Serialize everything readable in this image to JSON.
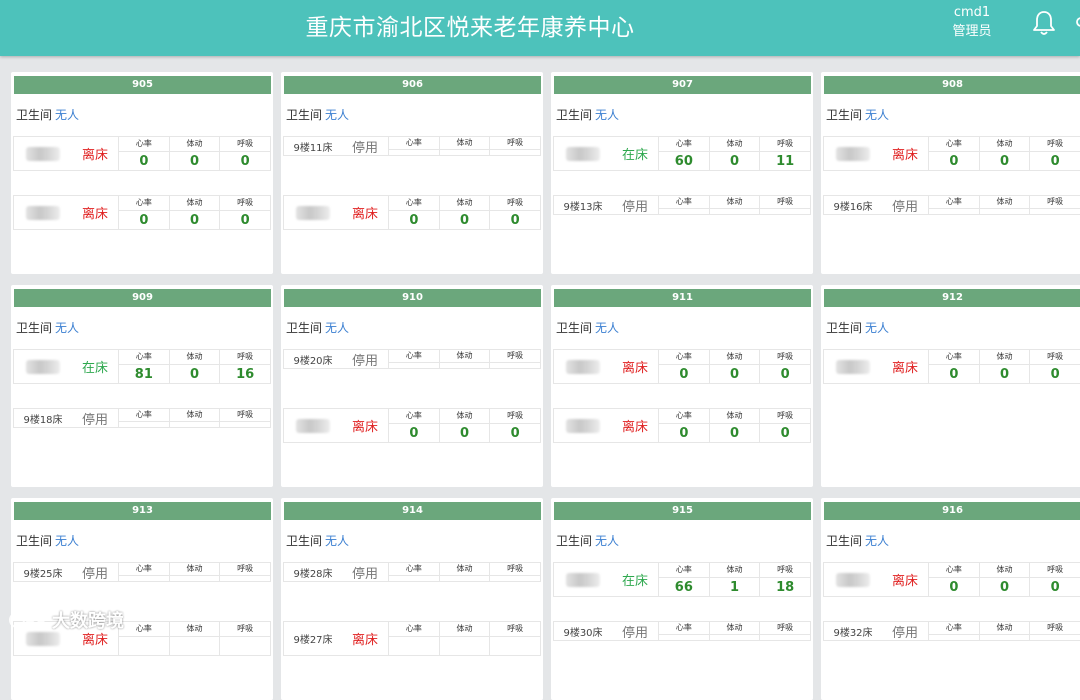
{
  "header": {
    "title": "重庆市渝北区悦来老年康养中心",
    "username": "cmd1",
    "role": "管理员"
  },
  "labels": {
    "toilet": "卫生间",
    "heart": "心率",
    "move": "体动",
    "breath": "呼吸"
  },
  "status_colors": {
    "离床": "#e02020",
    "在床": "#2ea84e",
    "停用": "#777777"
  },
  "watermark": "大数跨境",
  "rooms": [
    {
      "name": "905",
      "toilet": "无人",
      "beds": [
        {
          "label": "",
          "status": "离床",
          "heart": "0",
          "move": "0",
          "breath": "0"
        },
        {
          "label": "",
          "status": "离床",
          "heart": "0",
          "move": "0",
          "breath": "0"
        }
      ]
    },
    {
      "name": "906",
      "toilet": "无人",
      "beds": [
        {
          "label": "9楼11床",
          "status": "停用",
          "heart": "",
          "move": "",
          "breath": ""
        },
        {
          "label": "",
          "status": "离床",
          "heart": "0",
          "move": "0",
          "breath": "0"
        }
      ]
    },
    {
      "name": "907",
      "toilet": "无人",
      "beds": [
        {
          "label": "",
          "status": "在床",
          "heart": "60",
          "move": "0",
          "breath": "11"
        },
        {
          "label": "9楼13床",
          "status": "停用",
          "heart": "",
          "move": "",
          "breath": ""
        }
      ]
    },
    {
      "name": "908",
      "toilet": "无人",
      "beds": [
        {
          "label": "",
          "status": "离床",
          "heart": "0",
          "move": "0",
          "breath": "0"
        },
        {
          "label": "9楼16床",
          "status": "停用",
          "heart": "",
          "move": "",
          "breath": ""
        }
      ]
    },
    {
      "name": "909",
      "toilet": "无人",
      "beds": [
        {
          "label": "",
          "status": "在床",
          "heart": "81",
          "move": "0",
          "breath": "16"
        },
        {
          "label": "9楼18床",
          "status": "停用",
          "heart": "",
          "move": "",
          "breath": ""
        }
      ]
    },
    {
      "name": "910",
      "toilet": "无人",
      "beds": [
        {
          "label": "9楼20床",
          "status": "停用",
          "heart": "",
          "move": "",
          "breath": ""
        },
        {
          "label": "",
          "status": "离床",
          "heart": "0",
          "move": "0",
          "breath": "0"
        }
      ]
    },
    {
      "name": "911",
      "toilet": "无人",
      "beds": [
        {
          "label": "",
          "status": "离床",
          "heart": "0",
          "move": "0",
          "breath": "0"
        },
        {
          "label": "",
          "status": "离床",
          "heart": "0",
          "move": "0",
          "breath": "0"
        }
      ]
    },
    {
      "name": "912",
      "toilet": "无人",
      "beds": [
        {
          "label": "",
          "status": "离床",
          "heart": "0",
          "move": "0",
          "breath": "0"
        }
      ]
    },
    {
      "name": "913",
      "toilet": "无人",
      "beds": [
        {
          "label": "9楼25床",
          "status": "停用",
          "heart": "",
          "move": "",
          "breath": ""
        },
        {
          "label": "",
          "status": "离床",
          "heart": "",
          "move": "",
          "breath": ""
        }
      ]
    },
    {
      "name": "914",
      "toilet": "无人",
      "beds": [
        {
          "label": "9楼28床",
          "status": "停用",
          "heart": "",
          "move": "",
          "breath": ""
        },
        {
          "label": "9楼27床",
          "status": "离床",
          "heart": "",
          "move": "",
          "breath": ""
        }
      ]
    },
    {
      "name": "915",
      "toilet": "无人",
      "beds": [
        {
          "label": "",
          "status": "在床",
          "heart": "66",
          "move": "1",
          "breath": "18"
        },
        {
          "label": "9楼30床",
          "status": "停用",
          "heart": "",
          "move": "",
          "breath": ""
        }
      ]
    },
    {
      "name": "916",
      "toilet": "无人",
      "beds": [
        {
          "label": "",
          "status": "离床",
          "heart": "0",
          "move": "0",
          "breath": "0"
        },
        {
          "label": "9楼32床",
          "status": "停用",
          "heart": "",
          "move": "",
          "breath": ""
        }
      ]
    }
  ]
}
